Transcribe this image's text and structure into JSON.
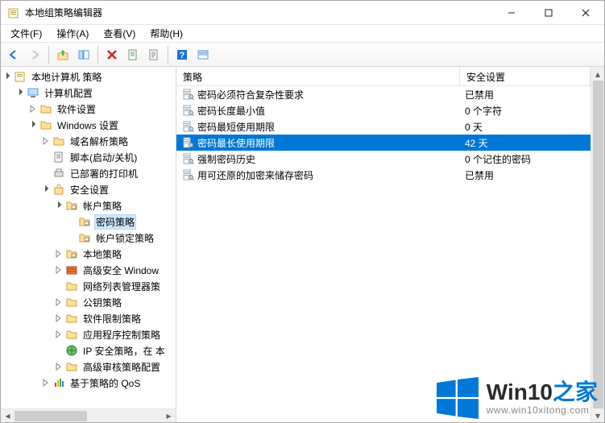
{
  "window": {
    "title": "本地组策略编辑器"
  },
  "menu": {
    "file": "文件(F)",
    "action": "操作(A)",
    "view": "查看(V)",
    "help": "帮助(H)"
  },
  "toolbar_icons": {
    "back": "back-icon",
    "forward": "forward-icon",
    "up": "up-icon",
    "show_hide_tree": "show-hide-tree-icon",
    "delete": "delete-icon",
    "export": "export-list-icon",
    "properties": "properties-icon",
    "refresh": "refresh-icon",
    "help": "help-icon",
    "view_mode": "view-mode-icon"
  },
  "tree": {
    "root": "本地计算机 策略",
    "computer_config": "计算机配置",
    "software_settings": "软件设置",
    "windows_settings": "Windows 设置",
    "name_resolution": "域名解析策略",
    "scripts": "脚本(启动/关机)",
    "deployed_printers": "已部署的打印机",
    "security_settings": "安全设置",
    "account_policies": "帐户策略",
    "password_policy": "密码策略",
    "lockout_policy": "帐户锁定策略",
    "local_policies": "本地策略",
    "firewall": "高级安全 Window",
    "network_list": "网络列表管理器策",
    "public_key": "公钥策略",
    "software_restrict": "软件限制策略",
    "app_control": "应用程序控制策略",
    "ipsec": "IP 安全策略，在 本",
    "audit": "高级审核策略配置",
    "qos": "基于策略的 QoS"
  },
  "list": {
    "header": {
      "policy": "策略",
      "setting": "安全设置"
    },
    "rows": [
      {
        "policy": "密码必须符合复杂性要求",
        "setting": "已禁用"
      },
      {
        "policy": "密码长度最小值",
        "setting": "0 个字符"
      },
      {
        "policy": "密码最短使用期限",
        "setting": "0 天"
      },
      {
        "policy": "密码最长使用期限",
        "setting": "42 天"
      },
      {
        "policy": "强制密码历史",
        "setting": "0 个记住的密码"
      },
      {
        "policy": "用可还原的加密来储存密码",
        "setting": "已禁用"
      }
    ],
    "selected_index": 3
  },
  "watermark": {
    "brand_prefix": "Win10",
    "brand_suffix": "之家",
    "url": "www.win10xitong.com"
  }
}
